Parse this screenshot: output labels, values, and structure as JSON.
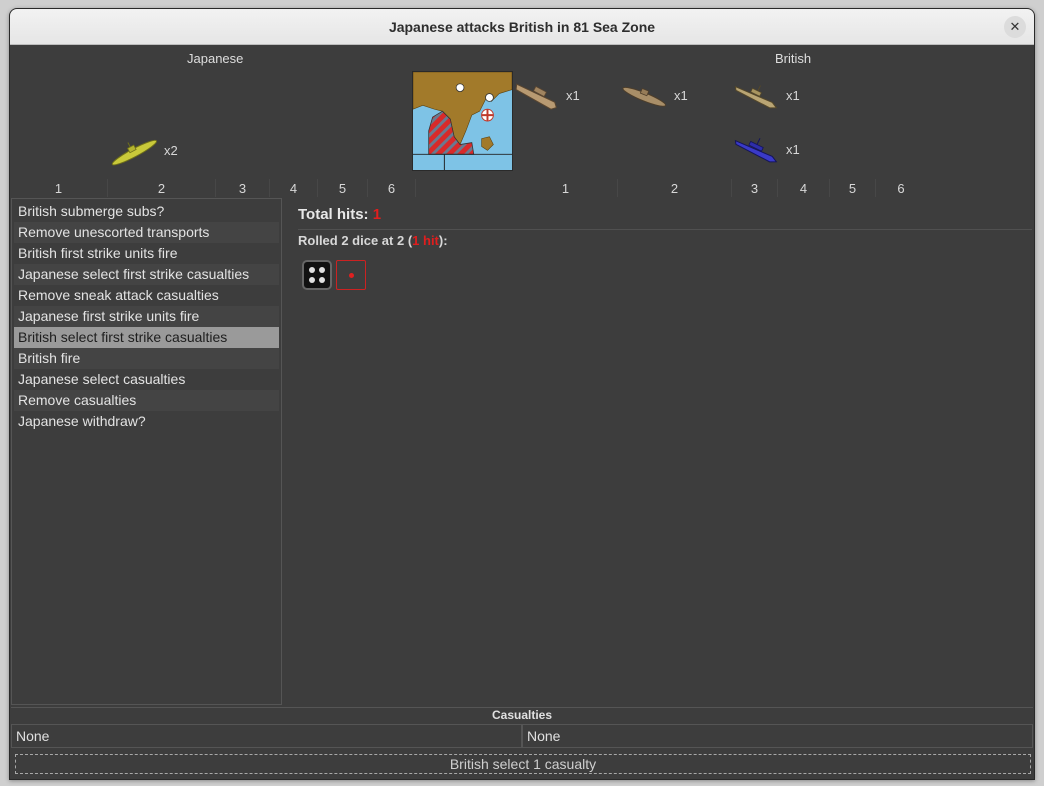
{
  "window": {
    "title": "Japanese attacks British in 81 Sea Zone",
    "close_glyph": "✕"
  },
  "battle": {
    "attacker": "Japanese",
    "defender": "British",
    "attacker_units": [
      {
        "name": "submarine",
        "count": "x2",
        "color": "#c9c93a"
      }
    ],
    "defender_units": [
      {
        "name": "transport",
        "count": "x1",
        "color": "#b89a72"
      },
      {
        "name": "submarine",
        "count": "x1",
        "color": "#a88e68"
      },
      {
        "name": "cruiser",
        "count": "x1",
        "color": "#b9a574"
      },
      {
        "name": "battleship",
        "count": "x1",
        "color": "#3a3ac8"
      }
    ],
    "attacker_dice_labels": [
      "1",
      "2",
      "3",
      "4",
      "5",
      "6"
    ],
    "defender_dice_labels": [
      "1",
      "2",
      "3",
      "4",
      "5",
      "6"
    ]
  },
  "steps": [
    "British submerge subs?",
    "Remove unescorted transports",
    "British first strike units fire",
    "Japanese select first strike casualties",
    "Remove sneak attack casualties",
    "Japanese first strike units fire",
    "British select first strike casualties",
    "British fire",
    "Japanese select casualties",
    "Remove casualties",
    "Japanese withdraw?"
  ],
  "selected_step": "British select first strike casualties",
  "log": {
    "total_hits_label": "Total hits:",
    "total_hits_value": "1",
    "roll_prefix": "Rolled 2 dice at 2 (",
    "roll_hit": "1 hit",
    "roll_suffix": "):"
  },
  "casualties": {
    "header": "Casualties",
    "attacker": "None",
    "defender": "None"
  },
  "status_button": "British select 1 casualty"
}
